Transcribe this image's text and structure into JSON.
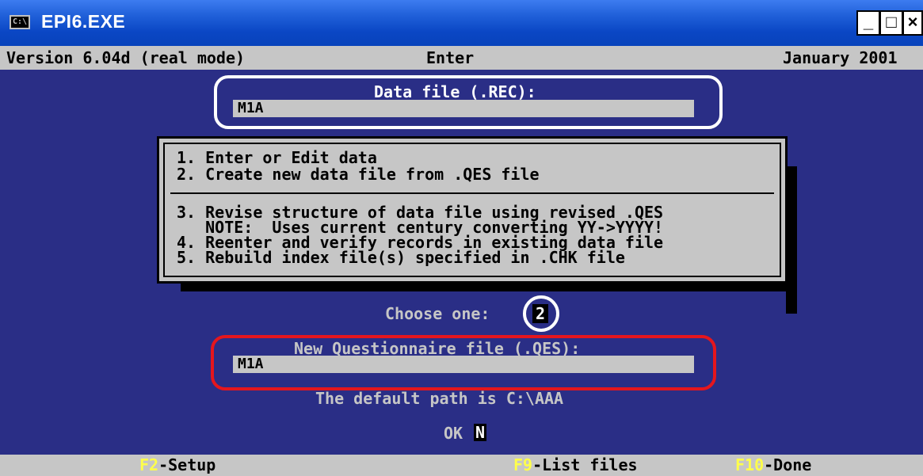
{
  "window": {
    "title": "EPI6.EXE",
    "icon_text": "C:\\",
    "minimize_label": "_",
    "maximize_label": "□",
    "close_label": "×"
  },
  "status": {
    "version": "Version 6.04d (real mode)",
    "mode": "Enter",
    "date": "January 2001"
  },
  "data_file": {
    "label": "Data file (.REC):",
    "value": "M1A"
  },
  "menu": {
    "items": [
      "1. Enter or Edit data",
      "2. Create new data file from .QES file",
      "3. Revise structure of data file using revised .QES",
      "   NOTE:  Uses current century converting YY->YYYY!",
      "4. Reenter and verify records in existing data file",
      "5. Rebuild index file(s) specified in .CHK file"
    ]
  },
  "choose": {
    "label": "Choose one:",
    "value": "2"
  },
  "questionnaire": {
    "label": "New Questionnaire file (.QES):",
    "value": "M1A"
  },
  "default_path": "The default path is C:\\AAA",
  "ok": {
    "label": "OK",
    "value": "N"
  },
  "function_keys": [
    {
      "key": "F2",
      "label": "-Setup"
    },
    {
      "key": "F9",
      "label": "-List files"
    },
    {
      "key": "F10",
      "label": "-Done"
    }
  ],
  "colors": {
    "console_bg": "#2a2e86",
    "title_bar": "#0a46c4",
    "fkey_yellow": "#ffff4a",
    "highlight_red": "#e5161d"
  }
}
